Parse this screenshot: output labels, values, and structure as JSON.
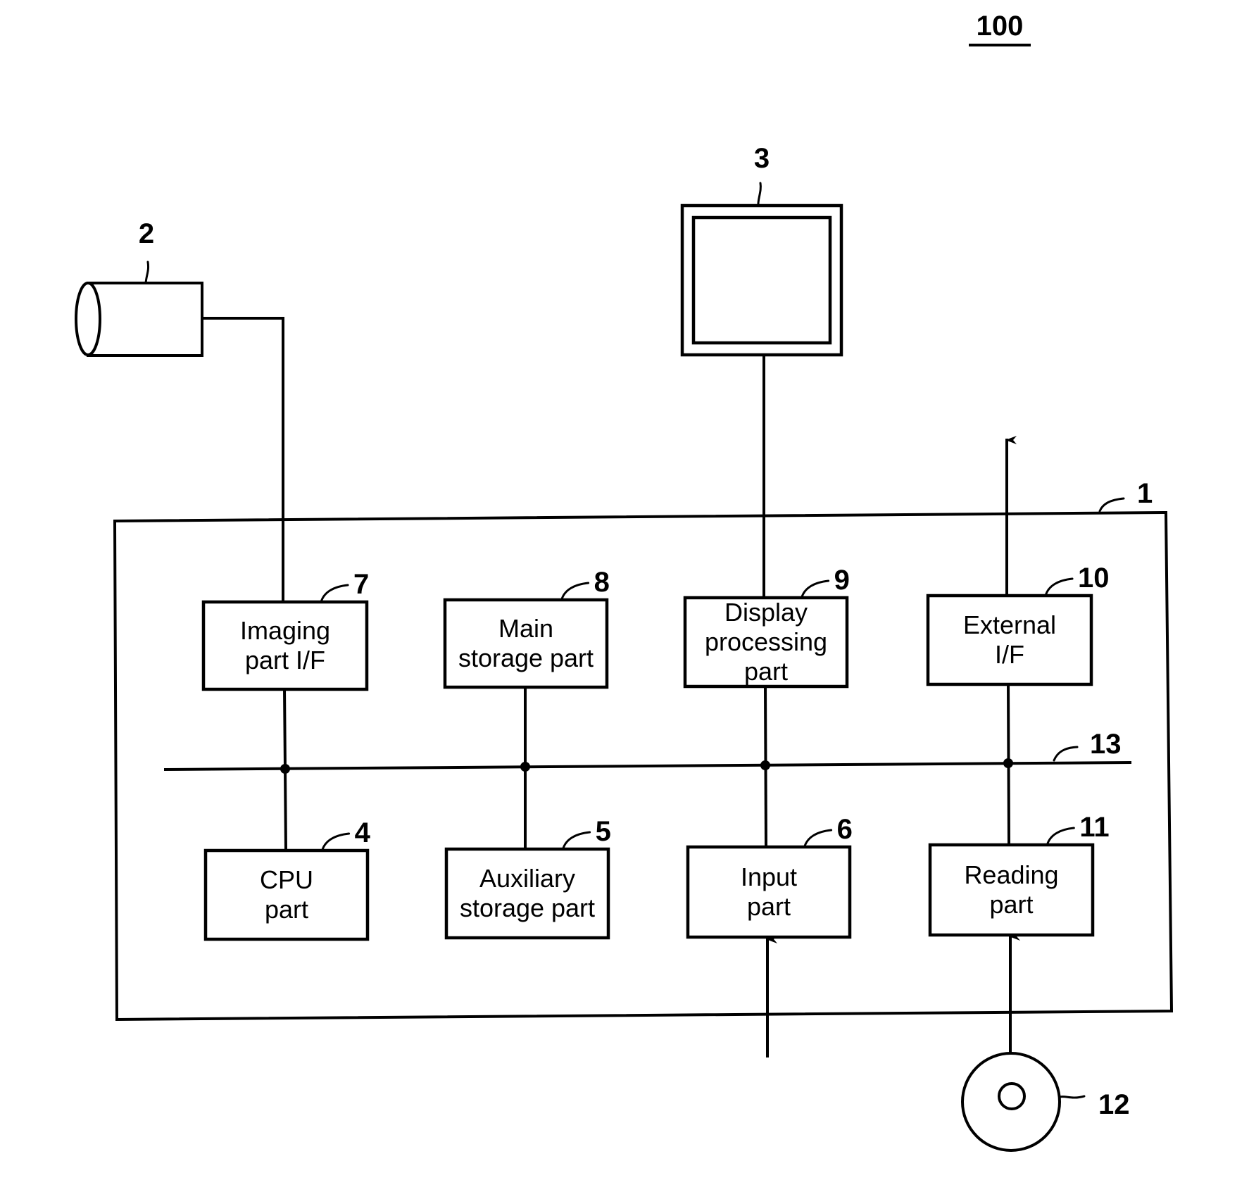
{
  "figure": {
    "ref": "100"
  },
  "system": {
    "ref": "1",
    "bus_ref": "13"
  },
  "peripherals": {
    "camera": {
      "ref": "2",
      "icon": "camera-icon"
    },
    "monitor": {
      "ref": "3",
      "icon": "monitor-icon"
    },
    "disc": {
      "ref": "12",
      "icon": "disc-icon"
    }
  },
  "blocks": [
    {
      "id": "imaging-part-if",
      "ref": "7",
      "lines": [
        "Imaging",
        "part I/F"
      ]
    },
    {
      "id": "main-storage-part",
      "ref": "8",
      "lines": [
        "Main",
        "storage part"
      ]
    },
    {
      "id": "display-processing-part",
      "ref": "9",
      "lines": [
        "Display",
        "processing",
        "part"
      ]
    },
    {
      "id": "external-if",
      "ref": "10",
      "lines": [
        "External",
        "I/F"
      ]
    },
    {
      "id": "cpu-part",
      "ref": "4",
      "lines": [
        "CPU",
        "part"
      ]
    },
    {
      "id": "auxiliary-storage-part",
      "ref": "5",
      "lines": [
        "Auxiliary",
        "storage part"
      ]
    },
    {
      "id": "input-part",
      "ref": "6",
      "lines": [
        "Input",
        "part"
      ]
    },
    {
      "id": "reading-part",
      "ref": "11",
      "lines": [
        "Reading",
        "part"
      ]
    }
  ]
}
